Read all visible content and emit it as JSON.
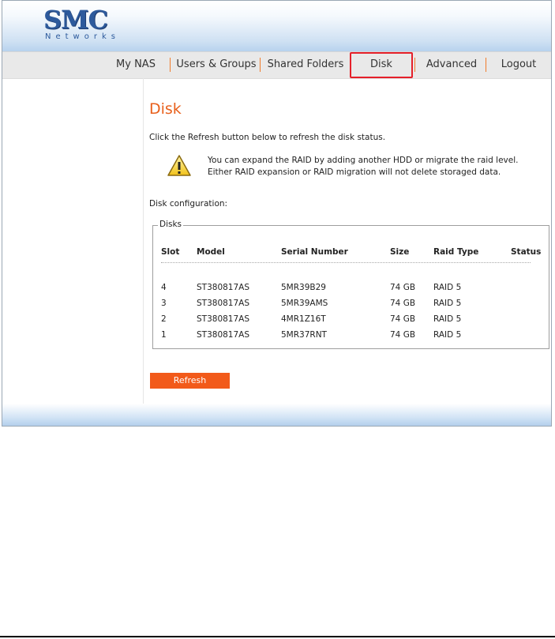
{
  "logo": {
    "brand": "SMC",
    "sub": "Networks"
  },
  "nav": {
    "items": [
      "My NAS",
      "Users & Groups",
      "Shared Folders",
      "Disk",
      "Advanced",
      "Logout"
    ],
    "active": "Disk",
    "separator_color": "#f07c2c",
    "highlight_color": "#e5202a"
  },
  "page": {
    "title": "Disk",
    "instruction": "Click the Refresh button below to refresh the disk status.",
    "notice_line1": "You can expand the RAID by adding another HDD or migrate the raid level.",
    "notice_line2": "Either RAID expansion or RAID migration will not delete storaged data.",
    "notice_icon": "warning-icon",
    "config_label": "Disk configuration:",
    "title_color": "#e8601c"
  },
  "disks": {
    "legend": "Disks",
    "columns": [
      "Slot",
      "Model",
      "Serial Number",
      "Size",
      "Raid Type",
      "Status"
    ],
    "rows": [
      [
        "4",
        "ST380817AS",
        "5MR39B29",
        "74 GB",
        "RAID 5",
        ""
      ],
      [
        "3",
        "ST380817AS",
        "5MR39AMS",
        "74 GB",
        "RAID 5",
        ""
      ],
      [
        "2",
        "ST380817AS",
        "4MR1Z16T",
        "74 GB",
        "RAID 5",
        ""
      ],
      [
        "1",
        "ST380817AS",
        "5MR37RNT",
        "74 GB",
        "RAID 5",
        ""
      ]
    ]
  },
  "refresh": {
    "label": "Refresh",
    "color": "#f25a1a"
  }
}
